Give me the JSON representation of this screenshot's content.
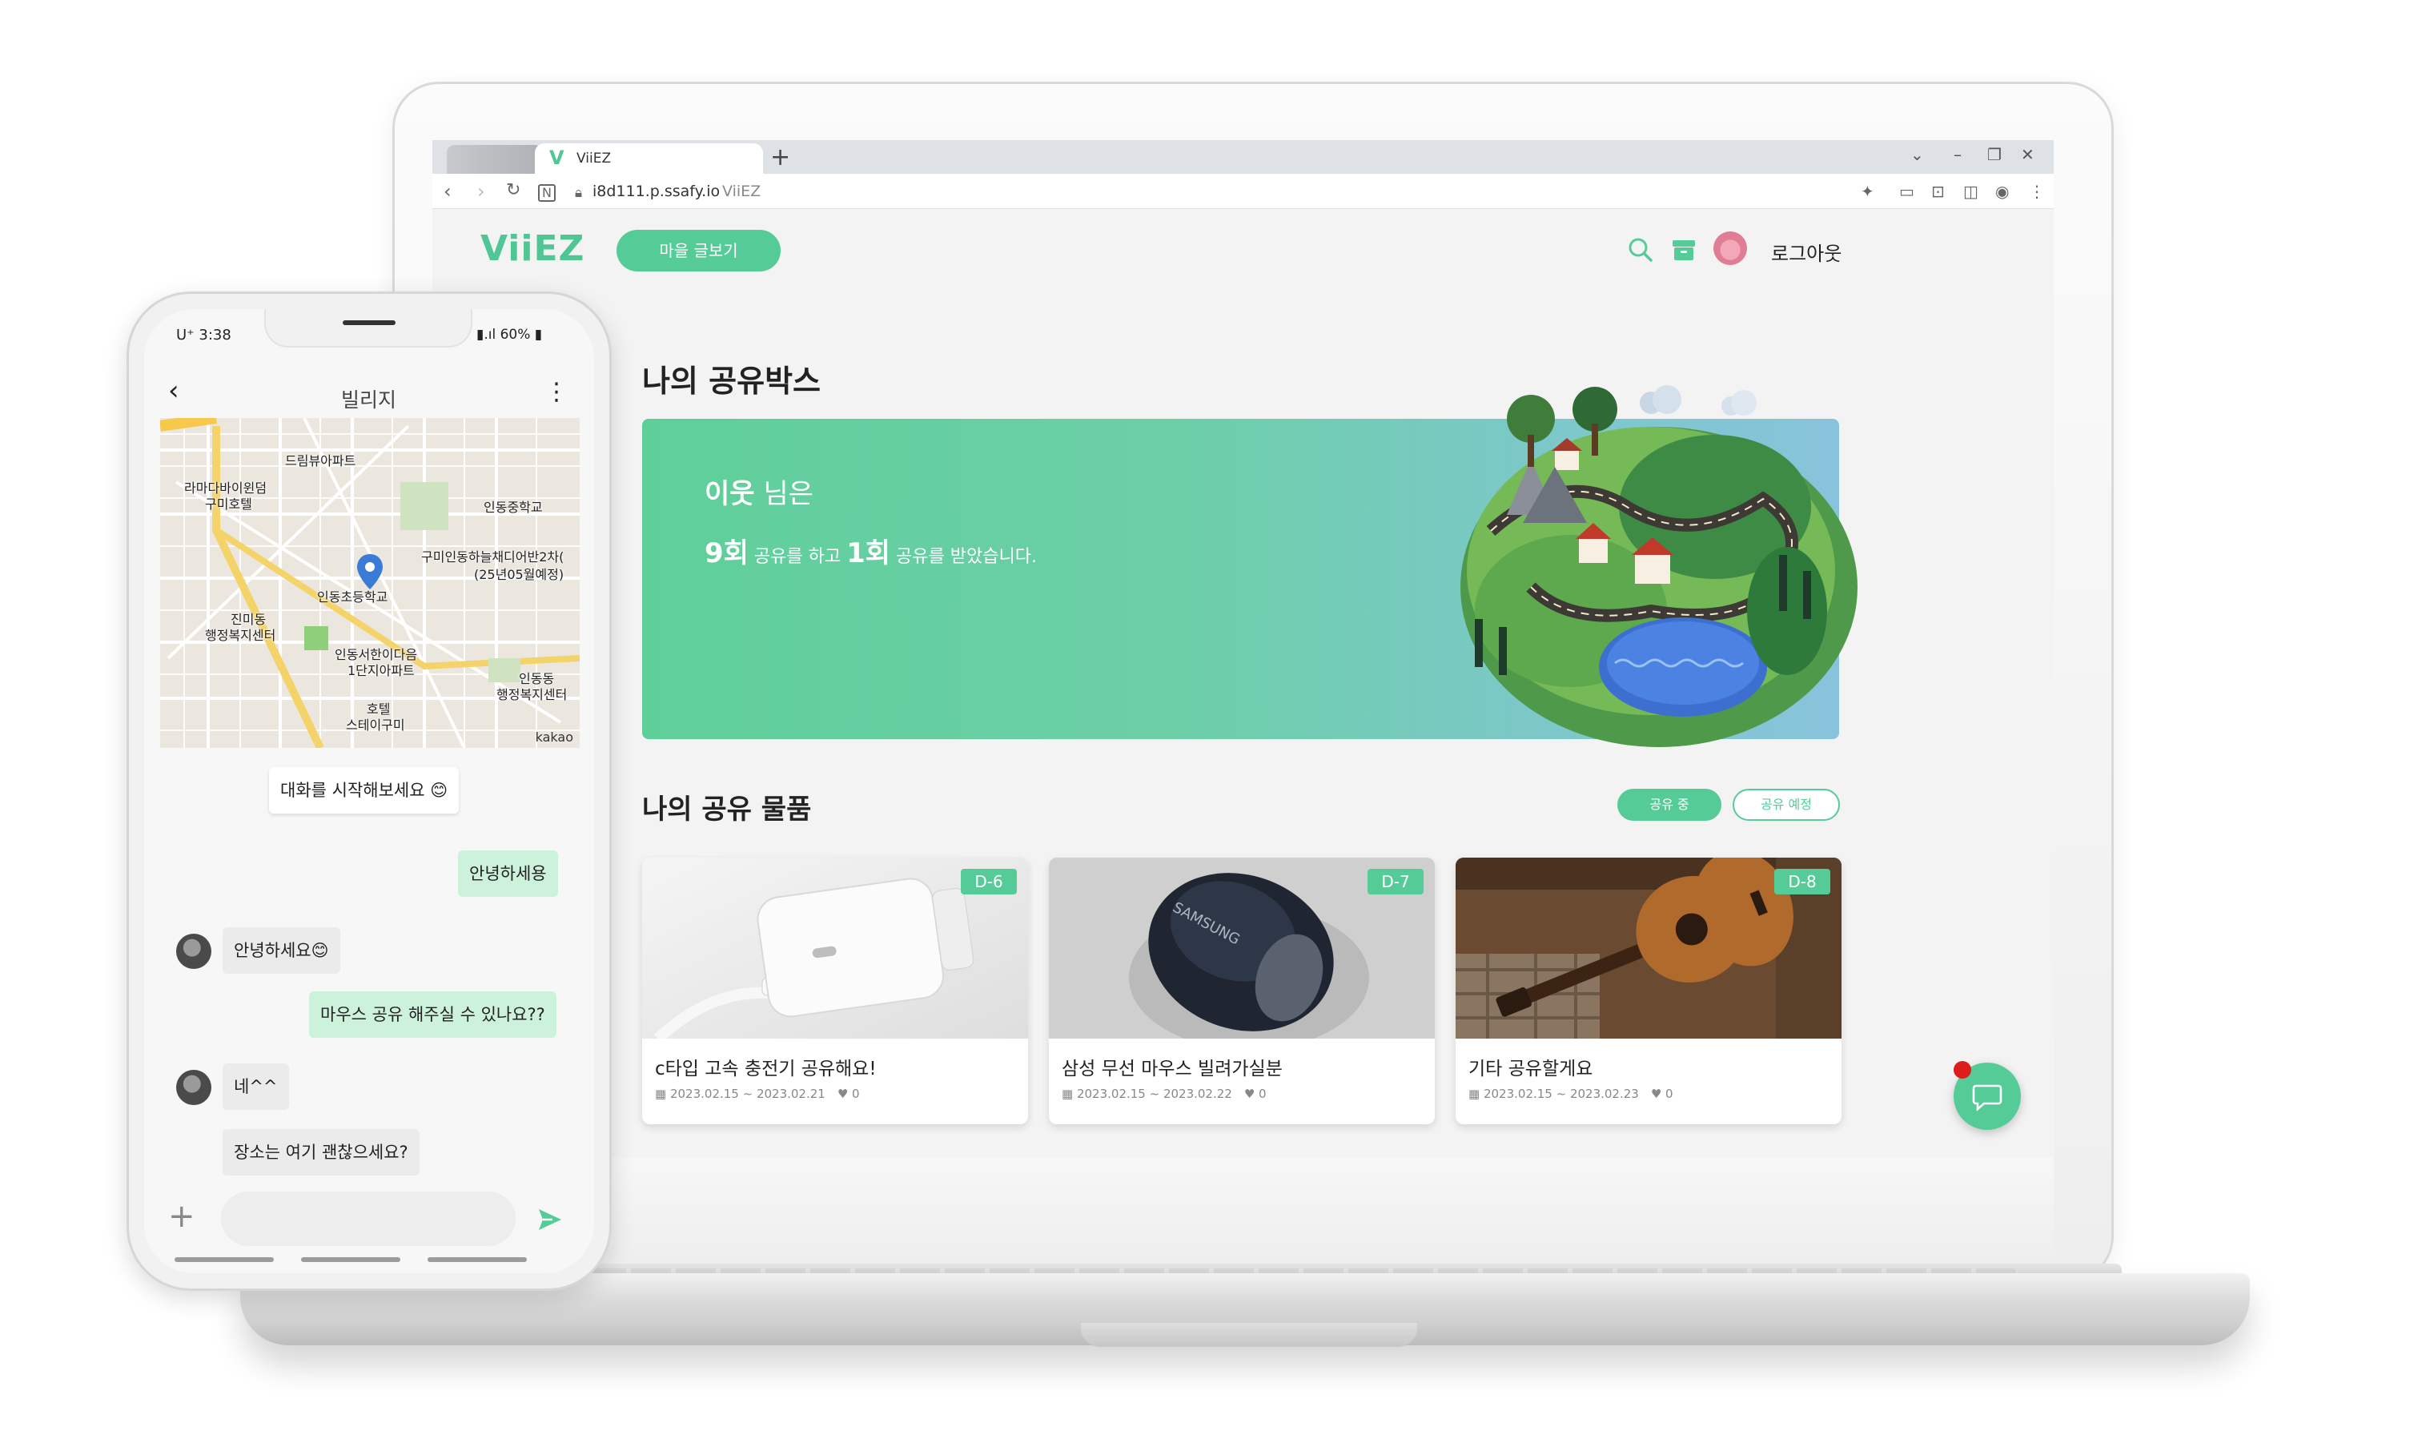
{
  "browser": {
    "tab_logo": "V",
    "tab_title": "ViiEZ",
    "new_tab": "+",
    "url": "i8d111.p.ssafy.io",
    "url_site": "ViiEZ"
  },
  "header": {
    "logo": "ViiEZ",
    "village_button": "마을 글보기",
    "logout": "로그아웃"
  },
  "sharebox": {
    "title": "나의 공유박스",
    "line1_prefix": "이웃",
    "line1_suffix": " 님은",
    "count_shared": "9회",
    "text_shared": " 공유를 하고 ",
    "count_received": "1회",
    "text_received": " 공유를 받았습니다."
  },
  "items": {
    "title": "나의 공유 물품",
    "pill_sharing": "공유 중",
    "pill_planned": "공유 예정",
    "cards": [
      {
        "dday": "D-6",
        "title": "c타입 고속 충전기 공유해요!",
        "period": "2023.02.15 ~ 2023.02.21",
        "likes": "0"
      },
      {
        "dday": "D-7",
        "title": "삼성 무선 마우스 빌려가실분",
        "period": "2023.02.15 ~ 2023.02.22",
        "likes": "0"
      },
      {
        "dday": "D-8",
        "title": "기타 공유할게요",
        "period": "2023.02.15 ~ 2023.02.23",
        "likes": "0"
      }
    ]
  },
  "phone": {
    "status_time": "U⁺ 3:38",
    "status_right": "60%",
    "chat_title": "빌리지",
    "map": {
      "labels": [
        "드림뷰아파트",
        "라마다바이윈덤",
        "구미호텔",
        "인동중학교",
        "구미인동하늘채디어반2차(",
        "(25년05월예정)",
        "인동초등학교",
        "진미동",
        "행정복지센터",
        "인동서한이다음",
        "1단지아파트",
        "인동동",
        "행정복지센터",
        "호텔",
        "스테이구미"
      ],
      "attribution": "kakao"
    },
    "messages": [
      {
        "type": "system",
        "text": "대화를 시작해보세요 😊"
      },
      {
        "type": "me",
        "text": "안녕하세용"
      },
      {
        "type": "other",
        "text": "안녕하세요😊"
      },
      {
        "type": "me",
        "text": "마우스 공유 해주실 수 있나요??"
      },
      {
        "type": "other",
        "text": "네^^"
      },
      {
        "type": "other",
        "text": "장소는 여기 괜찮으세요?"
      }
    ]
  },
  "colors": {
    "brand": "#55cc97",
    "notification": "#e01b1b"
  }
}
